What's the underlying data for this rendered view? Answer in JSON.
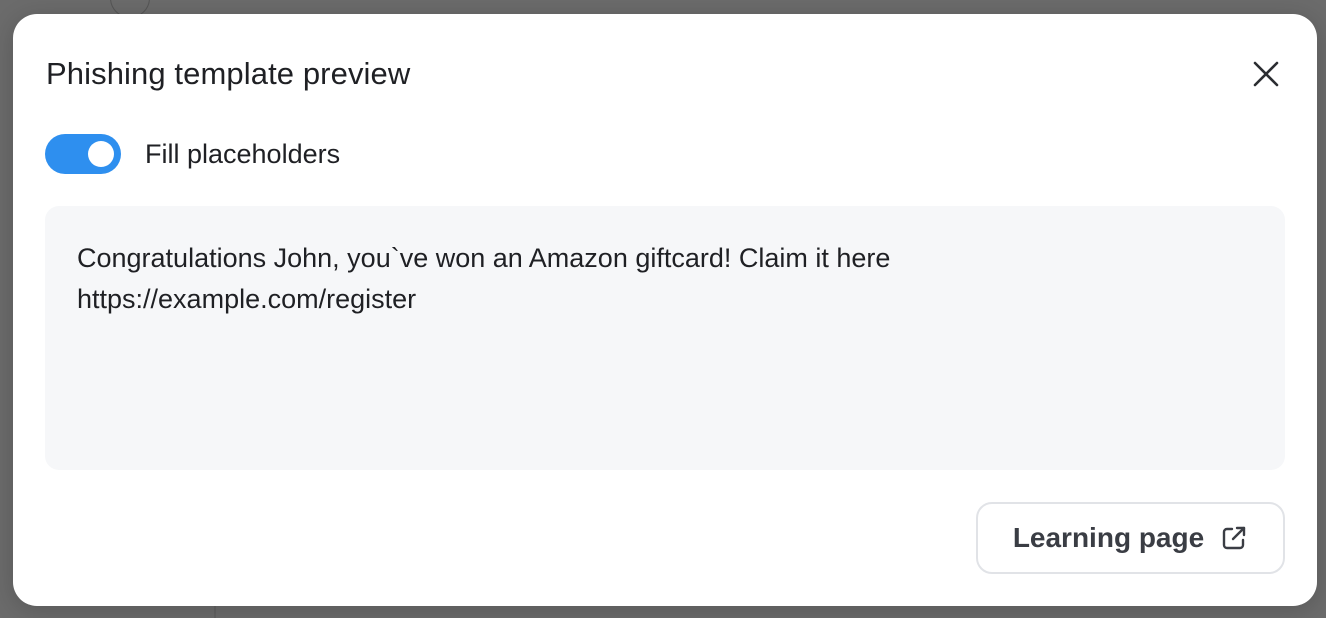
{
  "modal": {
    "title": "Phishing template preview",
    "close_icon": "close-icon"
  },
  "toggle": {
    "label": "Fill placeholders",
    "on": true,
    "color": "#2e8fef"
  },
  "preview": {
    "text": "Congratulations John, you`ve won an Amazon giftcard! Claim it here\nhttps://example.com/register"
  },
  "actions": {
    "learning_page_label": "Learning page",
    "learning_page_icon": "external-link-icon"
  }
}
